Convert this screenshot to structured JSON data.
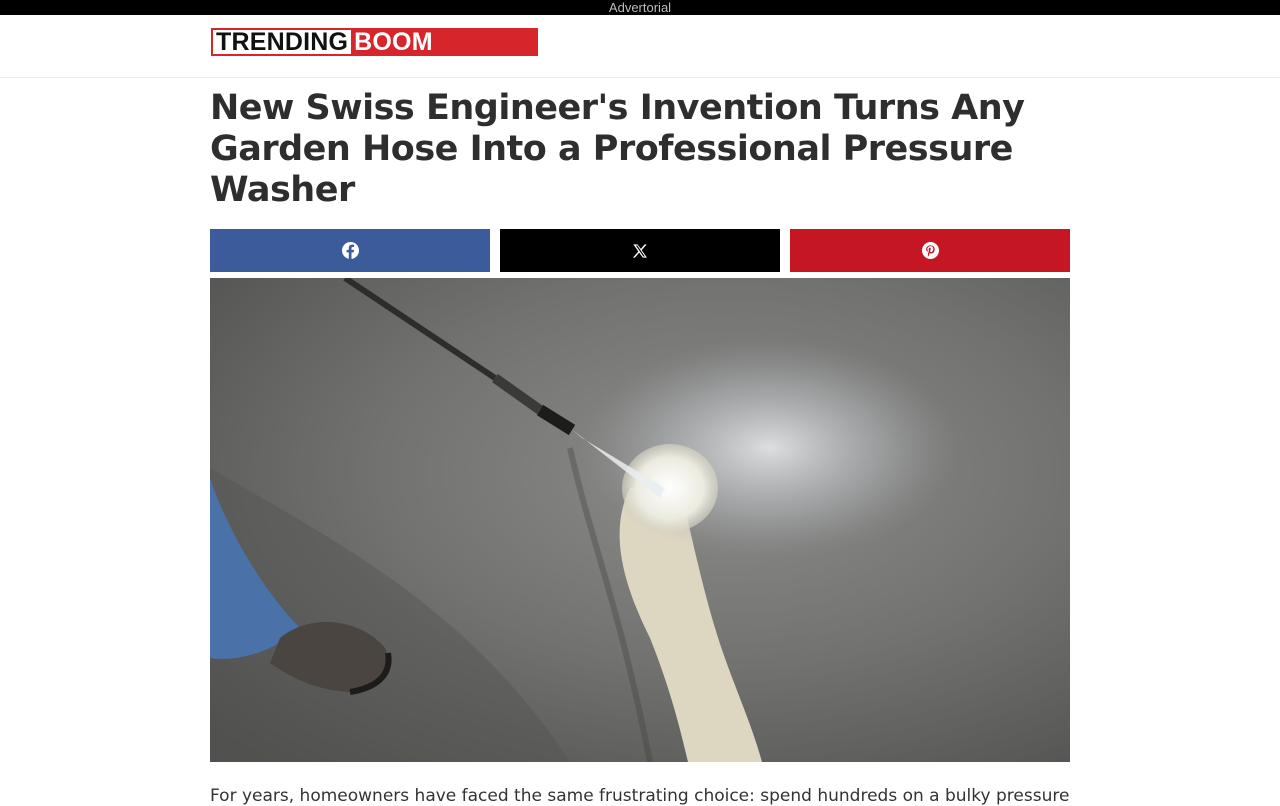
{
  "topbar": {
    "label": "Advertorial"
  },
  "logo": {
    "part1": "TRENDING",
    "part2": "BOOM",
    "border_color": "#d7262b"
  },
  "article": {
    "title": "New Swiss Engineer's Invention Turns Any Garden Hose Into a Professional Pressure Washer",
    "intro": "For years, homeowners have faced the same frustrating choice: spend hundreds on a bulky pressure"
  },
  "share": {
    "facebook": {
      "icon": "facebook-icon",
      "color": "#3b5b9b"
    },
    "x": {
      "icon": "x-icon",
      "color": "#000000"
    },
    "pinterest": {
      "icon": "pinterest-icon",
      "color": "#c51624"
    }
  },
  "hero_image": {
    "subject": "pressure-washer-cleaning-concrete"
  }
}
